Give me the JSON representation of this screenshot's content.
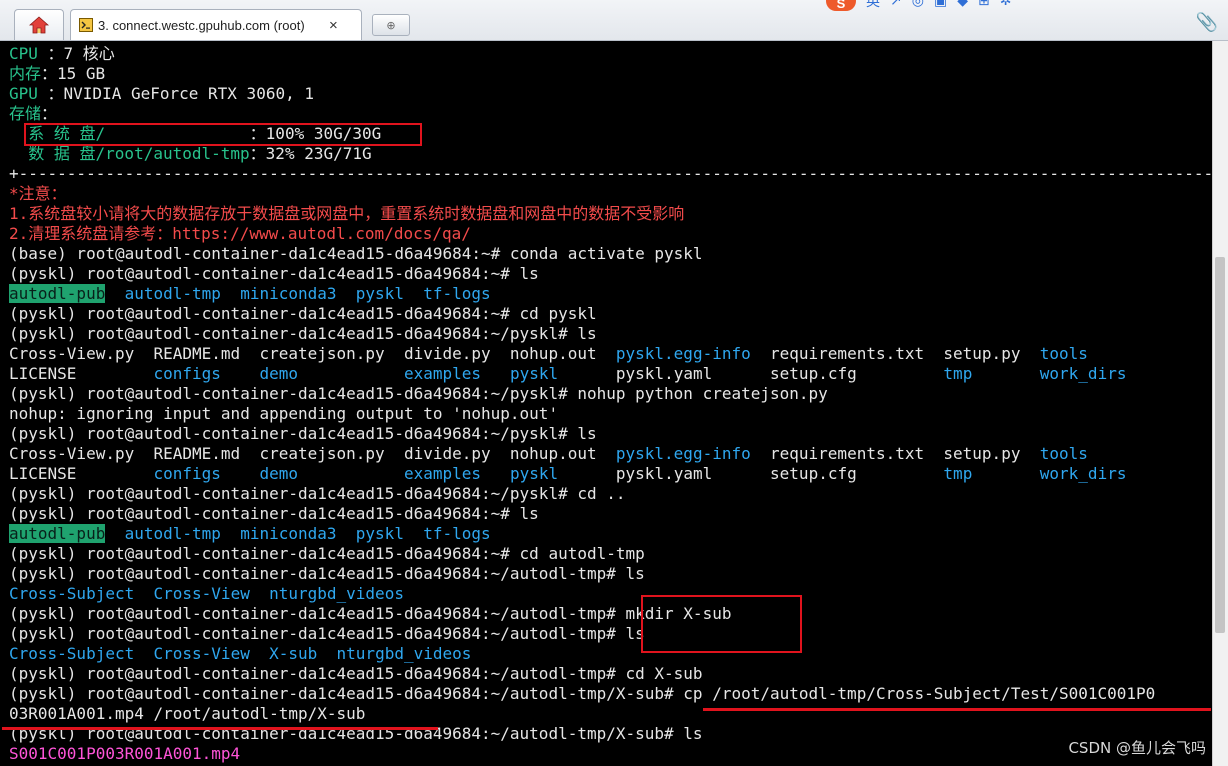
{
  "tabbar": {
    "home_icon": "home-icon",
    "session_tab": {
      "icon": "terminal-icon",
      "title": "3. connect.westc.gpuhub.com (root)",
      "close_label": "×"
    },
    "new_tab_label": "⊕",
    "tray_logo_text": "S",
    "tray_ime_text": "英",
    "attach_icon": "paperclip-icon"
  },
  "colors": {
    "default": "#e6e6e6",
    "green": "#28c28c",
    "red": "#f34b4b",
    "blue": "#2fa7ef",
    "pink": "#ff55d9",
    "highlight_bg": "#1fa36f",
    "annotation": "#e0131d"
  },
  "terminal": {
    "lines": [
      [
        {
          "t": "CPU ",
          "c": "green"
        },
        {
          "t": "：7 核心",
          "c": "default"
        }
      ],
      [
        {
          "t": "内存",
          "c": "green"
        },
        {
          "t": "：15 GB",
          "c": "default"
        }
      ],
      [
        {
          "t": "GPU ",
          "c": "green"
        },
        {
          "t": "：NVIDIA GeForce RTX 3060, 1",
          "c": "default"
        }
      ],
      [
        {
          "t": "存储",
          "c": "green"
        },
        {
          "t": "：",
          "c": "default"
        }
      ],
      [
        {
          "t": "  系 统 盘/               ",
          "c": "green"
        },
        {
          "t": "：100% 30G/30G",
          "c": "default"
        }
      ],
      [
        {
          "t": "  数 据 盘/root/autodl-tmp",
          "c": "green"
        },
        {
          "t": "：32% 23G/71G",
          "c": "default"
        }
      ],
      [
        {
          "t": "+----------------------------------------------------------------------------------------------------------------------------------------------+",
          "c": "default"
        }
      ],
      [
        {
          "t": "*注意：",
          "c": "red"
        }
      ],
      [
        {
          "t": "1.系统盘较小请将大的数据存放于数据盘或网盘中，重置系统时数据盘和网盘中的数据不受影响",
          "c": "red"
        }
      ],
      [
        {
          "t": "2.清理系统盘请参考：https://www.autodl.com/docs/qa/",
          "c": "red"
        }
      ],
      [
        {
          "t": "(base) root@autodl-container-da1c4ead15-d6a49684:~# conda activate pyskl",
          "c": "default"
        }
      ],
      [
        {
          "t": "(pyskl) root@autodl-container-da1c4ead15-d6a49684:~# ls",
          "c": "default"
        }
      ],
      [
        {
          "t": "autodl-pub",
          "c": "hl"
        },
        {
          "t": "  ",
          "c": "default"
        },
        {
          "t": "autodl-tmp",
          "c": "blue"
        },
        {
          "t": "  ",
          "c": "default"
        },
        {
          "t": "miniconda3",
          "c": "blue"
        },
        {
          "t": "  ",
          "c": "default"
        },
        {
          "t": "pyskl",
          "c": "blue"
        },
        {
          "t": "  ",
          "c": "default"
        },
        {
          "t": "tf-logs",
          "c": "blue"
        }
      ],
      [
        {
          "t": "(pyskl) root@autodl-container-da1c4ead15-d6a49684:~# cd pyskl",
          "c": "default"
        }
      ],
      [
        {
          "t": "(pyskl) root@autodl-container-da1c4ead15-d6a49684:~/pyskl# ls",
          "c": "default"
        }
      ],
      [
        {
          "t": "Cross-View.py  README.md  createjson.py  divide.py  nohup.out  ",
          "c": "default"
        },
        {
          "t": "pyskl.egg-info",
          "c": "blue"
        },
        {
          "t": "  requirements.txt  setup.py  ",
          "c": "default"
        },
        {
          "t": "tools",
          "c": "blue"
        }
      ],
      [
        {
          "t": "LICENSE        ",
          "c": "default"
        },
        {
          "t": "configs",
          "c": "blue"
        },
        {
          "t": "    ",
          "c": "default"
        },
        {
          "t": "demo",
          "c": "blue"
        },
        {
          "t": "           ",
          "c": "default"
        },
        {
          "t": "examples",
          "c": "blue"
        },
        {
          "t": "   ",
          "c": "default"
        },
        {
          "t": "pyskl",
          "c": "blue"
        },
        {
          "t": "      pyskl.yaml      setup.cfg         ",
          "c": "default"
        },
        {
          "t": "tmp",
          "c": "blue"
        },
        {
          "t": "       ",
          "c": "default"
        },
        {
          "t": "work_dirs",
          "c": "blue"
        }
      ],
      [
        {
          "t": "(pyskl) root@autodl-container-da1c4ead15-d6a49684:~/pyskl# nohup python createjson.py",
          "c": "default"
        }
      ],
      [
        {
          "t": "nohup: ignoring input and appending output to 'nohup.out'",
          "c": "default"
        }
      ],
      [
        {
          "t": "(pyskl) root@autodl-container-da1c4ead15-d6a49684:~/pyskl# ls",
          "c": "default"
        }
      ],
      [
        {
          "t": "Cross-View.py  README.md  createjson.py  divide.py  nohup.out  ",
          "c": "default"
        },
        {
          "t": "pyskl.egg-info",
          "c": "blue"
        },
        {
          "t": "  requirements.txt  setup.py  ",
          "c": "default"
        },
        {
          "t": "tools",
          "c": "blue"
        }
      ],
      [
        {
          "t": "LICENSE        ",
          "c": "default"
        },
        {
          "t": "configs",
          "c": "blue"
        },
        {
          "t": "    ",
          "c": "default"
        },
        {
          "t": "demo",
          "c": "blue"
        },
        {
          "t": "           ",
          "c": "default"
        },
        {
          "t": "examples",
          "c": "blue"
        },
        {
          "t": "   ",
          "c": "default"
        },
        {
          "t": "pyskl",
          "c": "blue"
        },
        {
          "t": "      pyskl.yaml      setup.cfg         ",
          "c": "default"
        },
        {
          "t": "tmp",
          "c": "blue"
        },
        {
          "t": "       ",
          "c": "default"
        },
        {
          "t": "work_dirs",
          "c": "blue"
        }
      ],
      [
        {
          "t": "(pyskl) root@autodl-container-da1c4ead15-d6a49684:~/pyskl# cd ..",
          "c": "default"
        }
      ],
      [
        {
          "t": "(pyskl) root@autodl-container-da1c4ead15-d6a49684:~# ls",
          "c": "default"
        }
      ],
      [
        {
          "t": "autodl-pub",
          "c": "hl"
        },
        {
          "t": "  ",
          "c": "default"
        },
        {
          "t": "autodl-tmp",
          "c": "blue"
        },
        {
          "t": "  ",
          "c": "default"
        },
        {
          "t": "miniconda3",
          "c": "blue"
        },
        {
          "t": "  ",
          "c": "default"
        },
        {
          "t": "pyskl",
          "c": "blue"
        },
        {
          "t": "  ",
          "c": "default"
        },
        {
          "t": "tf-logs",
          "c": "blue"
        }
      ],
      [
        {
          "t": "(pyskl) root@autodl-container-da1c4ead15-d6a49684:~# cd autodl-tmp",
          "c": "default"
        }
      ],
      [
        {
          "t": "(pyskl) root@autodl-container-da1c4ead15-d6a49684:~/autodl-tmp# ls",
          "c": "default"
        }
      ],
      [
        {
          "t": "Cross-Subject",
          "c": "blue"
        },
        {
          "t": "  ",
          "c": "default"
        },
        {
          "t": "Cross-View",
          "c": "blue"
        },
        {
          "t": "  ",
          "c": "default"
        },
        {
          "t": "nturgbd_videos",
          "c": "blue"
        }
      ],
      [
        {
          "t": "(pyskl) root@autodl-container-da1c4ead15-d6a49684:~/autodl-tmp# mkdir X-sub",
          "c": "default"
        }
      ],
      [
        {
          "t": "(pyskl) root@autodl-container-da1c4ead15-d6a49684:~/autodl-tmp# ls",
          "c": "default"
        }
      ],
      [
        {
          "t": "Cross-Subject",
          "c": "blue"
        },
        {
          "t": "  ",
          "c": "default"
        },
        {
          "t": "Cross-View",
          "c": "blue"
        },
        {
          "t": "  ",
          "c": "default"
        },
        {
          "t": "X-sub",
          "c": "blue"
        },
        {
          "t": "  ",
          "c": "default"
        },
        {
          "t": "nturgbd_videos",
          "c": "blue"
        }
      ],
      [
        {
          "t": "(pyskl) root@autodl-container-da1c4ead15-d6a49684:~/autodl-tmp# cd X-sub",
          "c": "default"
        }
      ],
      [
        {
          "t": "(pyskl) root@autodl-container-da1c4ead15-d6a49684:~/autodl-tmp/X-sub# cp /root/autodl-tmp/Cross-Subject/Test/S001C001P0",
          "c": "default"
        }
      ],
      [
        {
          "t": "03R001A001.mp4 /root/autodl-tmp/X-sub",
          "c": "default"
        }
      ],
      [
        {
          "t": "(pyskl) root@autodl-container-da1c4ead15-d6a49684:~/autodl-tmp/X-sub# ls",
          "c": "default"
        }
      ],
      [
        {
          "t": "S001C001P003R001A001.mp4",
          "c": "pink"
        }
      ]
    ]
  },
  "watermark": "CSDN @鱼儿会飞吗"
}
